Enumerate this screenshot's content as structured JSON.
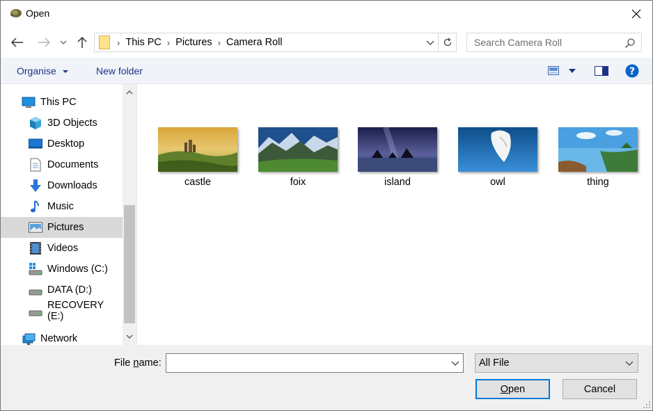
{
  "window": {
    "title": "Open"
  },
  "address": {
    "crumbs": [
      "This PC",
      "Pictures",
      "Camera Roll"
    ]
  },
  "search": {
    "placeholder": "Search Camera Roll"
  },
  "toolbar": {
    "organise": "Organise",
    "new_folder": "New folder"
  },
  "nav": {
    "items": [
      {
        "label": "This PC",
        "icon": "pc-icon"
      },
      {
        "label": "3D Objects",
        "icon": "cube-icon"
      },
      {
        "label": "Desktop",
        "icon": "desktop-icon"
      },
      {
        "label": "Documents",
        "icon": "document-icon"
      },
      {
        "label": "Downloads",
        "icon": "download-icon"
      },
      {
        "label": "Music",
        "icon": "music-icon"
      },
      {
        "label": "Pictures",
        "icon": "pictures-icon",
        "selected": true
      },
      {
        "label": "Videos",
        "icon": "video-icon"
      },
      {
        "label": "Windows (C:)",
        "icon": "drive-windows-icon"
      },
      {
        "label": "DATA (D:)",
        "icon": "drive-icon"
      },
      {
        "label": "RECOVERY (E:)",
        "icon": "drive-icon"
      },
      {
        "label": "Network",
        "icon": "network-icon"
      }
    ]
  },
  "files": [
    {
      "name": "castle"
    },
    {
      "name": "foix"
    },
    {
      "name": "island"
    },
    {
      "name": "owl"
    },
    {
      "name": "thing"
    }
  ],
  "bottom": {
    "file_name_label": "File name:",
    "file_name_value": "",
    "filter": "All File",
    "open": "Open",
    "cancel": "Cancel"
  },
  "colors": {
    "accent": "#0078d7",
    "link": "#1e3287",
    "selected": "#d9d9d9"
  }
}
